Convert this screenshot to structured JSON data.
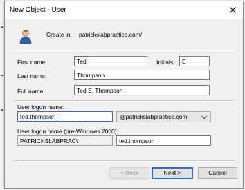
{
  "dialog": {
    "title": "New Object - User",
    "create_in_label": "Create in:",
    "create_in_value": "patrickslabpractice.com/"
  },
  "form": {
    "first_name_label": "First name:",
    "first_name_value": "Ted",
    "initials_label": "Initials:",
    "initials_value": "E",
    "last_name_label": "Last name:",
    "last_name_value": "Thompson",
    "full_name_label": "Full name:",
    "full_name_value": "Ted E. Thompson",
    "logon_name_label": "User logon name:",
    "logon_name_value": "ted.thompson",
    "upn_suffix_selected": "@patrickslabpractice.com",
    "pre2000_label": "User logon name (pre-Windows 2000):",
    "pre2000_domain": "PATRICKSLABPRAC\\",
    "pre2000_value": "ted.thompson"
  },
  "buttons": {
    "back": "< Back",
    "next": "Next >",
    "cancel": "Cancel"
  },
  "colors": {
    "accent": "#2b6dd1",
    "window_bg": "#f0f0f0"
  },
  "icons": {
    "object_icon": "user-icon",
    "close": "close-icon",
    "dropdown": "chevron-down-icon"
  }
}
